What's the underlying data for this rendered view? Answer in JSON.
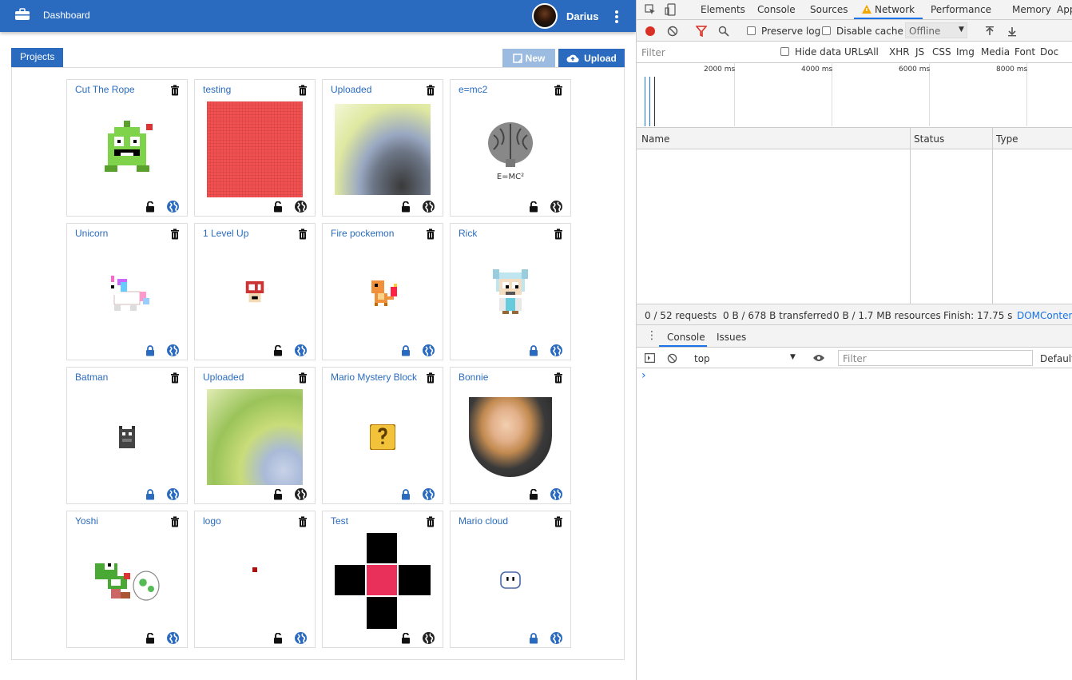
{
  "app": {
    "header": {
      "title": "Dashboard",
      "user": "Darius"
    },
    "tabs": {
      "projects": "Projects"
    },
    "actions": {
      "new_label": "New",
      "upload_label": "Upload"
    },
    "projects": [
      {
        "title": "Cut The Rope",
        "locked": false,
        "globe": "blue",
        "thumb": "omnom"
      },
      {
        "title": "testing",
        "locked": false,
        "globe": "dark",
        "thumb": "redsquare"
      },
      {
        "title": "Uploaded",
        "locked": false,
        "globe": "dark",
        "thumb": "photo1"
      },
      {
        "title": "e=mc2",
        "locked": false,
        "globe": "dark",
        "thumb": "brain",
        "caption": "E=MC²"
      },
      {
        "title": "Unicorn",
        "locked": true,
        "globe": "blue",
        "thumb": "unicorn"
      },
      {
        "title": "1 Level Up",
        "locked": false,
        "globe": "blue",
        "thumb": "mushroom"
      },
      {
        "title": "Fire pockemon",
        "locked": true,
        "globe": "blue",
        "thumb": "charmander"
      },
      {
        "title": "Rick",
        "locked": true,
        "globe": "blue",
        "thumb": "rick"
      },
      {
        "title": "Batman",
        "locked": true,
        "globe": "blue",
        "thumb": "batman"
      },
      {
        "title": "Uploaded",
        "locked": false,
        "globe": "dark",
        "thumb": "photo2"
      },
      {
        "title": "Mario Mystery Block",
        "locked": true,
        "globe": "blue",
        "thumb": "qblock"
      },
      {
        "title": "Bonnie",
        "locked": false,
        "globe": "blue",
        "thumb": "portrait"
      },
      {
        "title": "Yoshi",
        "locked": false,
        "globe": "blue",
        "thumb": "yoshi"
      },
      {
        "title": "logo",
        "locked": false,
        "globe": "blue",
        "thumb": "dot"
      },
      {
        "title": "Test",
        "locked": false,
        "globe": "dark",
        "thumb": "cross"
      },
      {
        "title": "Mario cloud",
        "locked": true,
        "globe": "blue",
        "thumb": "cloud"
      }
    ]
  },
  "devtools": {
    "tabs": [
      "Elements",
      "Console",
      "Sources",
      "Network",
      "Performance",
      "Memory",
      "App"
    ],
    "active_tab": "Network",
    "toolbar": {
      "preserve_log": "Preserve log",
      "disable_cache": "Disable cache",
      "throttling": "Offline"
    },
    "filter_placeholder": "Filter",
    "hide_data_urls": "Hide data URLs",
    "type_filters": [
      "All",
      "XHR",
      "JS",
      "CSS",
      "Img",
      "Media",
      "Font",
      "Doc"
    ],
    "timeline_ticks": [
      "2000 ms",
      "4000 ms",
      "6000 ms",
      "8000 ms"
    ],
    "columns": [
      "Name",
      "Status",
      "Type"
    ],
    "status": {
      "requests": "0 / 52 requests",
      "transferred": "0 B / 678 B transferred",
      "resources": "0 B / 1.7 MB resources",
      "finish": "Finish: 17.75 s",
      "domcontent": "DOMContent"
    },
    "console": {
      "tabs": [
        "Console",
        "Issues"
      ],
      "context": "top",
      "filter_placeholder": "Filter",
      "levels": "Default",
      "prompt": "›"
    }
  }
}
